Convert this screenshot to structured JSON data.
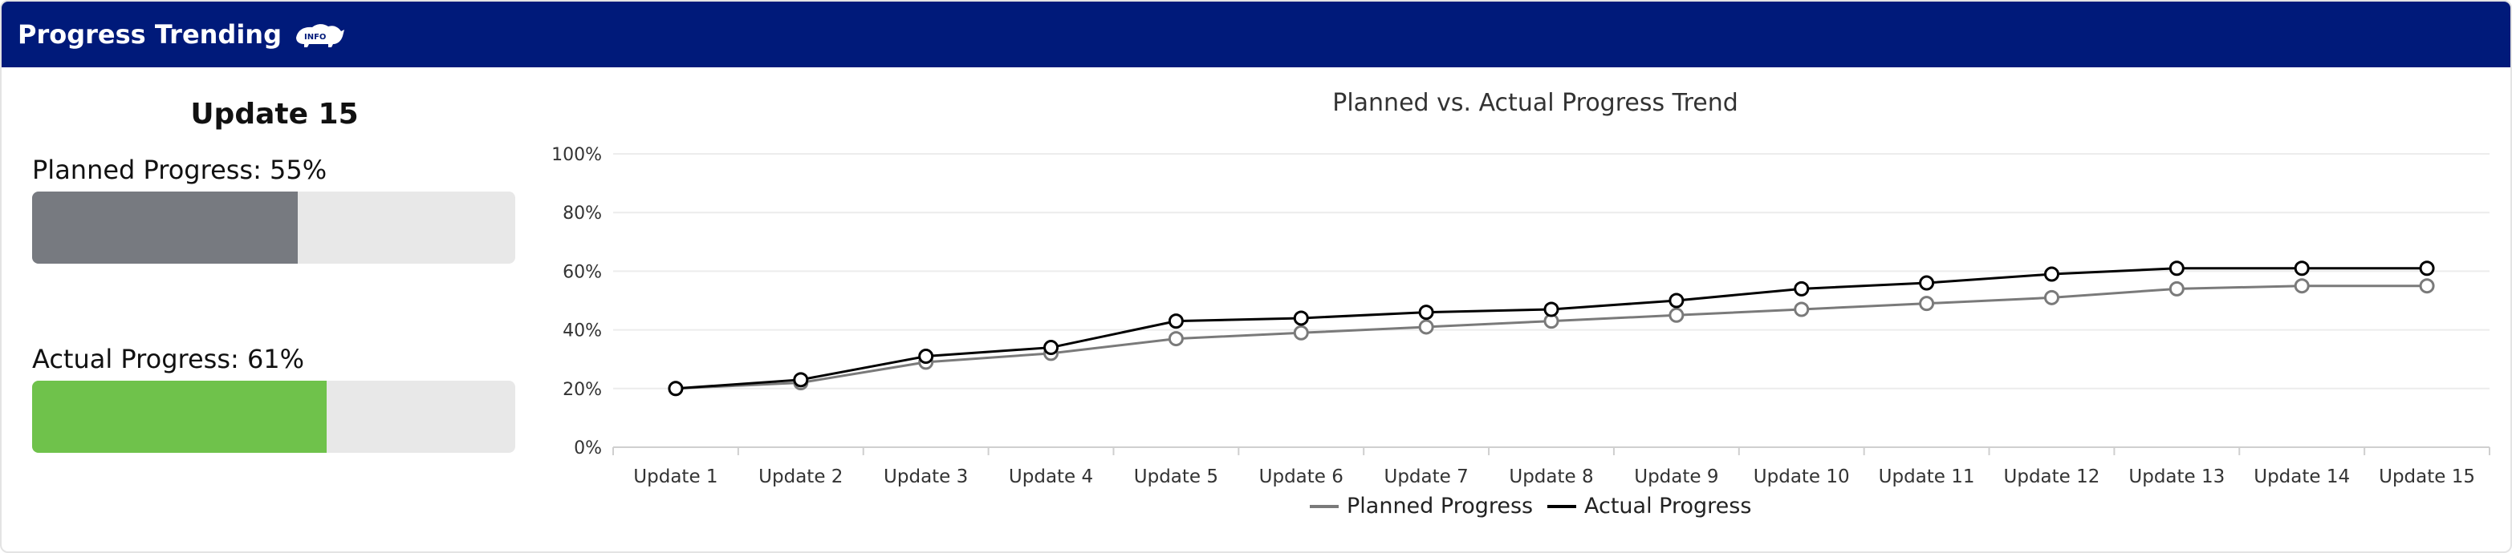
{
  "header": {
    "title": "Progress Trending",
    "logo_text": "INFO",
    "logo_icon": "rhino-icon"
  },
  "summary": {
    "update_title": "Update 15",
    "planned_label": "Planned Progress: 55%",
    "planned_value": 55,
    "actual_label": "Actual Progress: 61%",
    "actual_value": 61
  },
  "colors": {
    "header_bg": "#001a7a",
    "planned_fill": "#777a80",
    "actual_fill": "#6fc24b",
    "track": "#e8e8e8",
    "planned_line": "#7a7a7a",
    "actual_line": "#000000"
  },
  "chart_data": {
    "type": "line",
    "title": "Planned vs. Actual Progress Trend",
    "xlabel": "",
    "ylabel": "",
    "categories": [
      "Update 1",
      "Update 2",
      "Update 3",
      "Update 4",
      "Update 5",
      "Update 6",
      "Update 7",
      "Update 8",
      "Update 9",
      "Update 10",
      "Update 11",
      "Update 12",
      "Update 13",
      "Update 14",
      "Update 15"
    ],
    "series": [
      {
        "name": "Planned Progress",
        "values": [
          20,
          22,
          29,
          32,
          37,
          39,
          41,
          43,
          45,
          47,
          49,
          51,
          54,
          55,
          55
        ]
      },
      {
        "name": "Actual Progress",
        "values": [
          20,
          23,
          31,
          34,
          43,
          44,
          46,
          47,
          50,
          54,
          56,
          59,
          61,
          61,
          61
        ]
      }
    ],
    "ylim": [
      0,
      100
    ],
    "y_ticks": [
      "0%",
      "20%",
      "40%",
      "60%",
      "80%",
      "100%"
    ],
    "grid": true,
    "legend": "bottom-center"
  }
}
